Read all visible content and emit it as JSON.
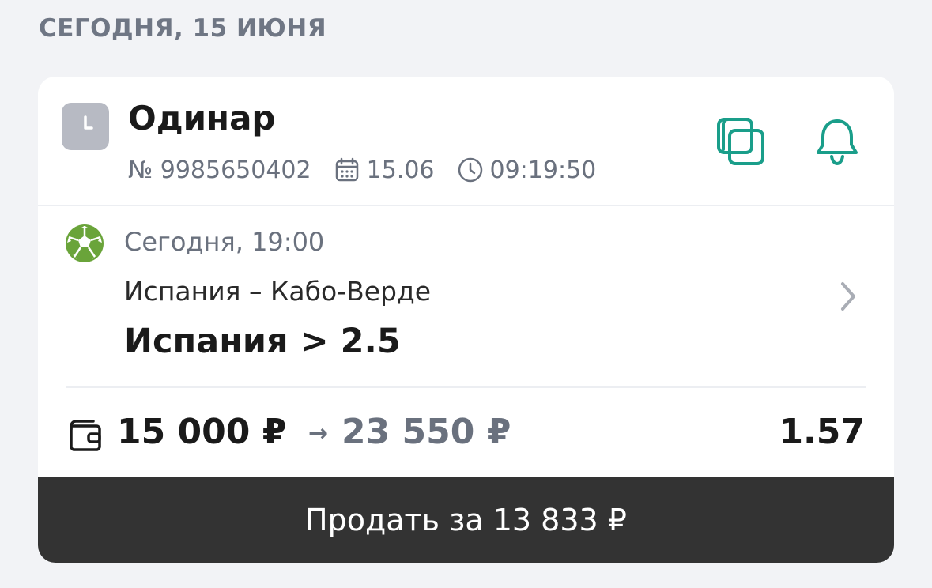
{
  "header": {
    "date_label": "СЕГОДНЯ, 15 ИЮНЯ"
  },
  "bet": {
    "type": "Одинар",
    "status_icon": "clock-icon",
    "number": "№ 9985650402",
    "date": "15.06",
    "time": "09:19:50",
    "actions": {
      "copy_icon": "copy-icon",
      "bell_icon": "bell-icon"
    }
  },
  "event": {
    "sport_icon": "football-icon",
    "start": "Сегодня, 19:00",
    "teams": "Испания – Кабо-Верде",
    "outcome": "Испания > 2.5"
  },
  "stake": {
    "amount": "15 000 ₽",
    "arrow": "→",
    "payout": "23 550 ₽",
    "coefficient": "1.57"
  },
  "sell": {
    "label": "Продать за 13 833 ₽"
  },
  "colors": {
    "accent": "#1a9e8a",
    "ball": "#6aa43a",
    "muted": "#6a717e",
    "button_bg": "#333333",
    "page_bg": "#f2f3f6"
  }
}
